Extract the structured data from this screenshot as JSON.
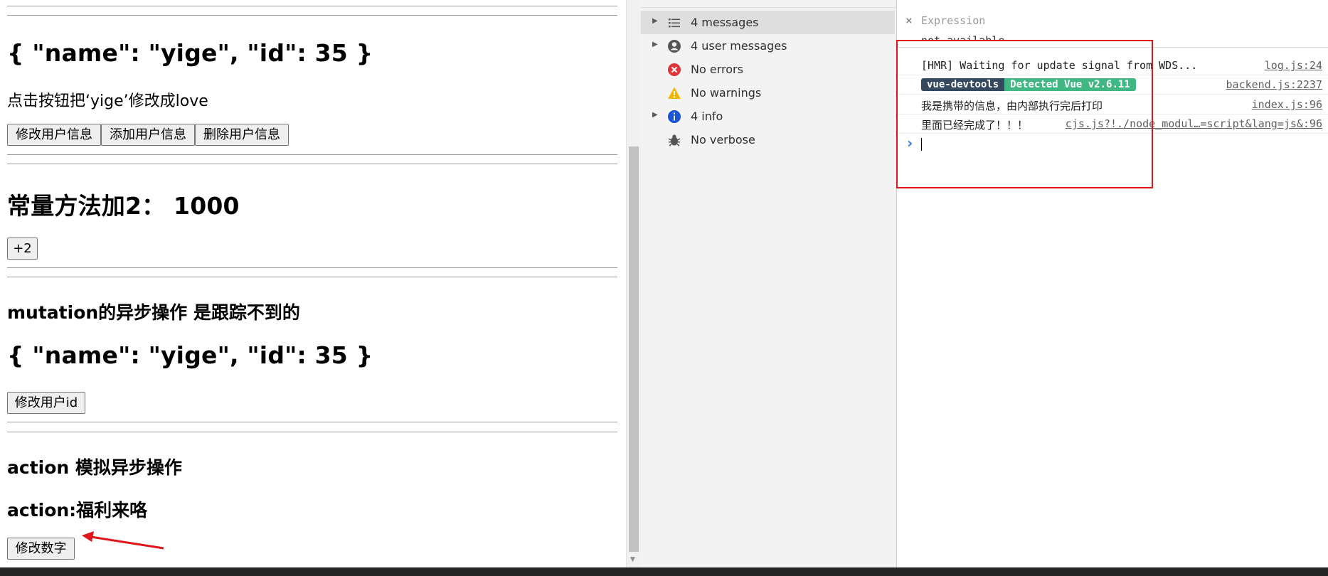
{
  "app": {
    "user_json_1": "{ \"name\": \"yige\", \"id\": 35 }",
    "instruction": "点击按钮把‘yige’修改成love",
    "buttons_user": [
      "修改用户信息",
      "添加用户信息",
      "删除用户信息"
    ],
    "constant_heading": "常量方法加2： 1000",
    "plus_two_button": "+2",
    "mutation_heading": "mutation的异步操作 是跟踪不到的",
    "user_json_2": "{ \"name\": \"yige\", \"id\": 35 }",
    "modify_id_button": "修改用户id",
    "action_heading": "action 模拟异步操作",
    "action_text": "action:福利来咯",
    "modify_number_button": "修改数字"
  },
  "devtools": {
    "sidebar": [
      {
        "label": "4 messages",
        "icon": "list-icon",
        "expandable": true,
        "selected": true
      },
      {
        "label": "4 user messages",
        "icon": "user-icon",
        "expandable": true,
        "selected": false
      },
      {
        "label": "No errors",
        "icon": "error-icon",
        "expandable": false,
        "selected": false
      },
      {
        "label": "No warnings",
        "icon": "warning-icon",
        "expandable": false,
        "selected": false
      },
      {
        "label": "4 info",
        "icon": "info-icon",
        "expandable": true,
        "selected": false
      },
      {
        "label": "No verbose",
        "icon": "bug-icon",
        "expandable": false,
        "selected": false
      }
    ],
    "expression": {
      "close_glyph": "×",
      "placeholder": "Expression",
      "value": "not available"
    },
    "console": [
      {
        "message": "[HMR] Waiting for update signal from WDS...",
        "source": "log.js:24"
      },
      {
        "badge_left": "vue-devtools",
        "badge_right": "Detected Vue v2.6.11",
        "source": "backend.js:2237"
      },
      {
        "message": "我是携带的信息，由内部执行完后打印",
        "source": "index.js:96"
      },
      {
        "message": "里面已经完成了！！！",
        "source": "cjs.js?!./node_modul…=script&lang=js&:96"
      }
    ],
    "prompt_glyph": "›"
  },
  "colors": {
    "highlight_box": "#e0161b",
    "annotation_arrow": "#e0161b",
    "badge_dark": "#35495e",
    "badge_green": "#41b883",
    "prompt_blue": "#1a73e8"
  }
}
